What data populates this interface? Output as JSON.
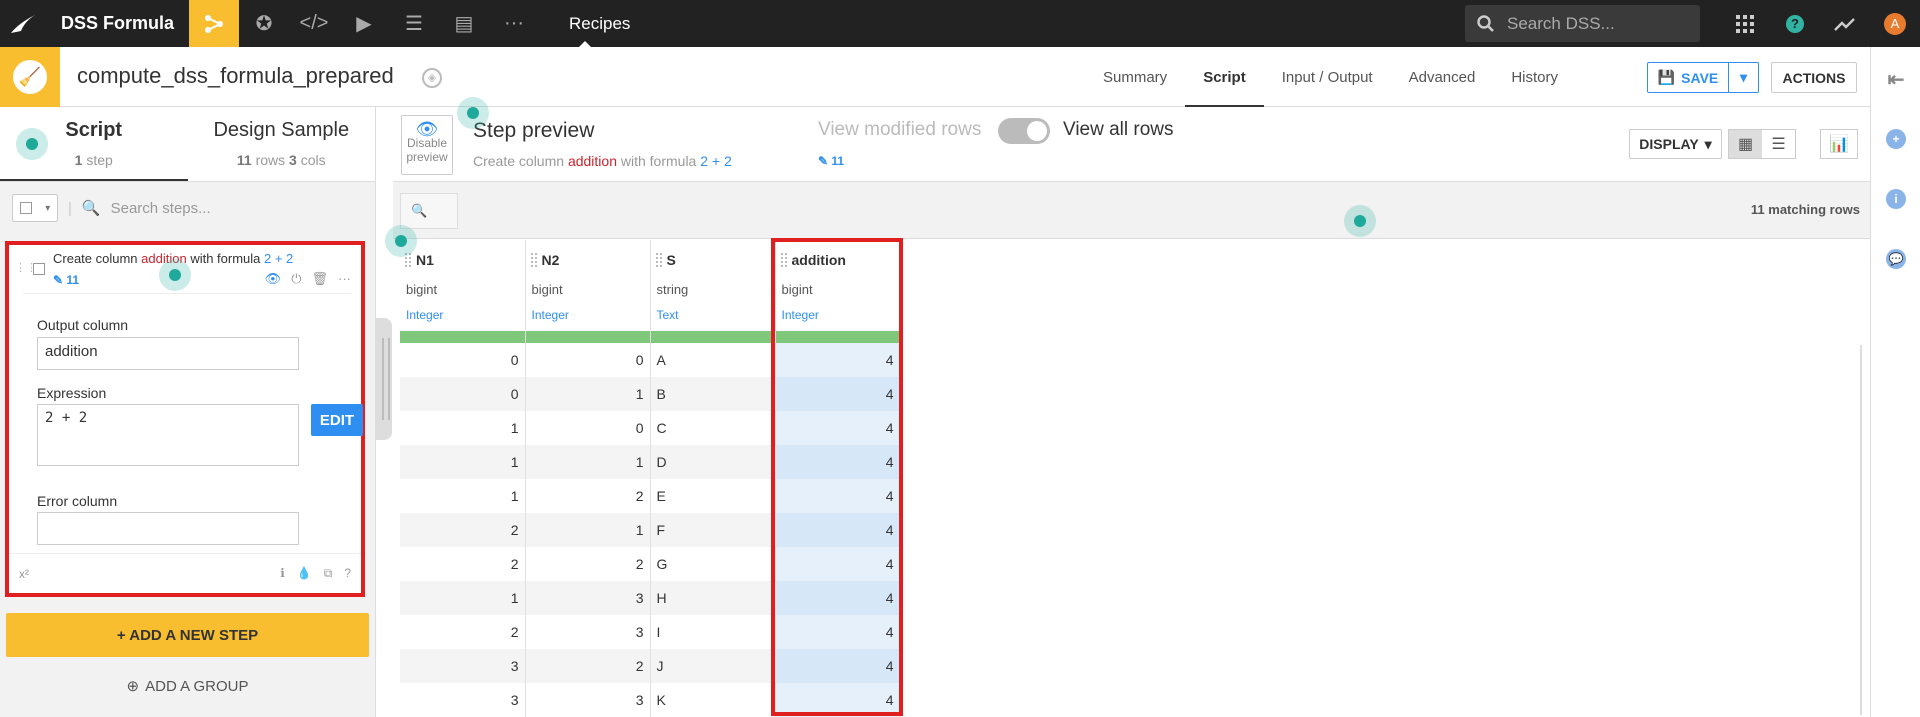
{
  "topnav": {
    "app_name": "DSS Formula",
    "section": "Recipes",
    "search_placeholder": "Search DSS...",
    "avatar_initial": "A",
    "help": "?"
  },
  "header": {
    "recipe_name": "compute_dss_formula_prepared",
    "tabs": [
      "Summary",
      "Script",
      "Input / Output",
      "Advanced",
      "History"
    ],
    "active_tab": "Script",
    "save_label": "SAVE",
    "actions_label": "ACTIONS"
  },
  "left": {
    "tab_script": "Script",
    "tab_script_count": "1",
    "tab_script_unit": "step",
    "tab_design": "Design Sample",
    "tab_design_rows": "11",
    "tab_design_rows_unit": "rows",
    "tab_design_cols": "3",
    "tab_design_cols_unit": "cols",
    "search_placeholder": "Search steps...",
    "step": {
      "title_prefix": "Create column ",
      "title_col": "addition",
      "title_mid": " with formula ",
      "title_formula": "2 + 2",
      "count": "11",
      "output_label": "Output column",
      "output_value": "addition",
      "expression_label": "Expression",
      "expression_value": "2 + 2",
      "edit_label": "EDIT",
      "error_label": "Error column",
      "error_value": "",
      "footer_icon": "x²"
    },
    "add_step": "+ ADD A NEW STEP",
    "add_group": "ADD A GROUP"
  },
  "preview": {
    "disable_line1": "Disable",
    "disable_line2": "preview",
    "title": "Step preview",
    "sub_prefix": "Create column ",
    "sub_col": "addition",
    "sub_mid": " with formula ",
    "sub_formula": "2 + 2",
    "view_modified": "View modified rows",
    "view_modified_count": "11",
    "view_all": "View all rows",
    "display_label": "DISPLAY",
    "matching": "11 matching rows"
  },
  "table": {
    "columns": [
      {
        "name": "N1",
        "type": "bigint",
        "meaning": "Integer"
      },
      {
        "name": "N2",
        "type": "bigint",
        "meaning": "Integer"
      },
      {
        "name": "S",
        "type": "string",
        "meaning": "Text"
      },
      {
        "name": "addition",
        "type": "bigint",
        "meaning": "Integer"
      }
    ],
    "rows": [
      [
        "0",
        "0",
        "A",
        "4"
      ],
      [
        "0",
        "1",
        "B",
        "4"
      ],
      [
        "1",
        "0",
        "C",
        "4"
      ],
      [
        "1",
        "1",
        "D",
        "4"
      ],
      [
        "1",
        "2",
        "E",
        "4"
      ],
      [
        "2",
        "1",
        "F",
        "4"
      ],
      [
        "2",
        "2",
        "G",
        "4"
      ],
      [
        "1",
        "3",
        "H",
        "4"
      ],
      [
        "2",
        "3",
        "I",
        "4"
      ],
      [
        "3",
        "2",
        "J",
        "4"
      ],
      [
        "3",
        "3",
        "K",
        "4"
      ]
    ]
  },
  "colors": {
    "accent": "#f9be2f",
    "blue": "#2f8ff0",
    "highlight": "#e02020",
    "teal": "#31b3a4"
  }
}
